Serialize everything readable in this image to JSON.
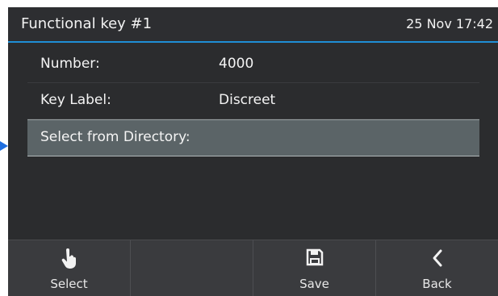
{
  "header": {
    "title": "Functional key #1",
    "datetime": "25 Nov 17:42"
  },
  "fields": [
    {
      "label": "Number:",
      "value": "4000"
    },
    {
      "label": "Key Label:",
      "value": "Discreet"
    },
    {
      "label": "Select from Directory:",
      "value": ""
    }
  ],
  "softkeys": [
    {
      "label": "Select",
      "icon": "hand-pointer-icon"
    },
    {
      "label": "",
      "icon": ""
    },
    {
      "label": "Save",
      "icon": "floppy-disk-icon"
    },
    {
      "label": "Back",
      "icon": "chevron-left-icon"
    }
  ],
  "colors": {
    "accent": "#1f8fd6",
    "background": "#2b2c2e",
    "selected_row": "#5b6467",
    "softkey_bar": "#3a3b3e"
  }
}
